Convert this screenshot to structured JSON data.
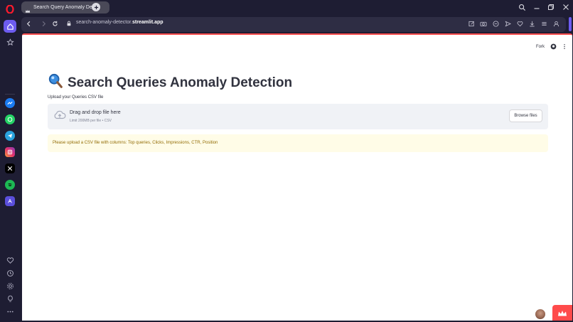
{
  "browser": {
    "tab": {
      "title": "Search Query Anomaly Dete",
      "favicon_icon": "streamlit-crown-icon"
    },
    "address_bar": {
      "url_prefix": "search-anomaly-detector.",
      "url_domain": "streamlit.app"
    },
    "accent_color": "#6d5cf0"
  },
  "sidebar": {
    "top_items": [
      {
        "name": "opera-logo-icon"
      },
      {
        "name": "home-icon"
      },
      {
        "name": "star-icon"
      }
    ],
    "apps": [
      {
        "name": "messenger-icon",
        "color": "#1b7cf2"
      },
      {
        "name": "whatsapp-icon",
        "color": "#25d366"
      },
      {
        "name": "telegram-icon",
        "color": "#2aa3df"
      },
      {
        "name": "instagram-icon",
        "color": "#e1306c"
      },
      {
        "name": "x-icon",
        "color": "#000000"
      },
      {
        "name": "spotify-icon",
        "color": "#1db954"
      },
      {
        "name": "aria-icon",
        "color": "#5b4fdc"
      }
    ],
    "bottom_items": [
      {
        "name": "heart-icon"
      },
      {
        "name": "history-icon"
      },
      {
        "name": "settings-icon"
      },
      {
        "name": "bulb-icon"
      },
      {
        "name": "more-icon"
      }
    ]
  },
  "app": {
    "header": {
      "fork_label": "Fork"
    },
    "title_icon": "magnifier-icon",
    "title": "Search Queries Anomaly Detection",
    "uploader": {
      "label": "Upload your Queries CSV file",
      "drop_text": "Drag and drop file here",
      "limit_text": "Limit 200MB per file • CSV",
      "browse_label": "Browse files"
    },
    "warning": "Please upload a CSV file with columns: Top queries, Clicks, Impressions, CTR, Position",
    "brand_color": "#ff4b4b"
  }
}
